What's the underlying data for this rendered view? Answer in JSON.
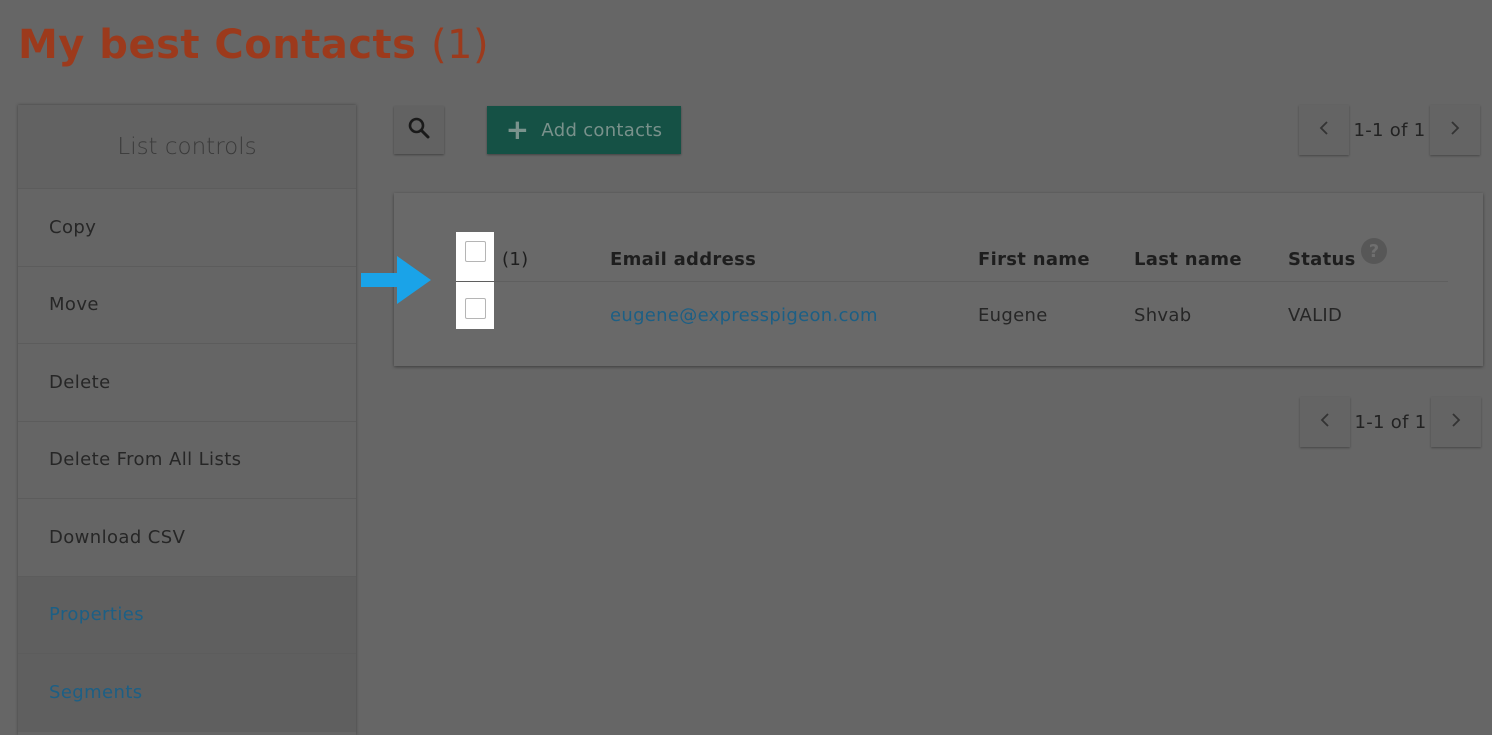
{
  "page": {
    "title": "My best Contacts",
    "count": "(1)"
  },
  "sidebar": {
    "header": "List controls",
    "items": [
      {
        "label": "Copy"
      },
      {
        "label": "Move"
      },
      {
        "label": "Delete"
      },
      {
        "label": "Delete From All Lists"
      },
      {
        "label": "Download CSV"
      },
      {
        "label": "Properties"
      },
      {
        "label": "Segments"
      }
    ]
  },
  "toolbar": {
    "search_icon": "search-icon",
    "add_label": "Add contacts",
    "add_icon": "plus-icon"
  },
  "pagination": {
    "top": "1-1 of 1",
    "bottom": "1-1 of 1"
  },
  "table": {
    "selected_count": "(1)",
    "columns": [
      "Email address",
      "First name",
      "Last name",
      "Status"
    ],
    "rows": [
      {
        "email": "eugene@expresspigeon.com",
        "first_name": "Eugene",
        "last_name": "Shvab",
        "status": "VALID"
      }
    ]
  },
  "colors": {
    "title": "#9c3a1c",
    "add_button": "#155145",
    "link": "#1c5f85",
    "arrow": "#1aa3e8"
  }
}
